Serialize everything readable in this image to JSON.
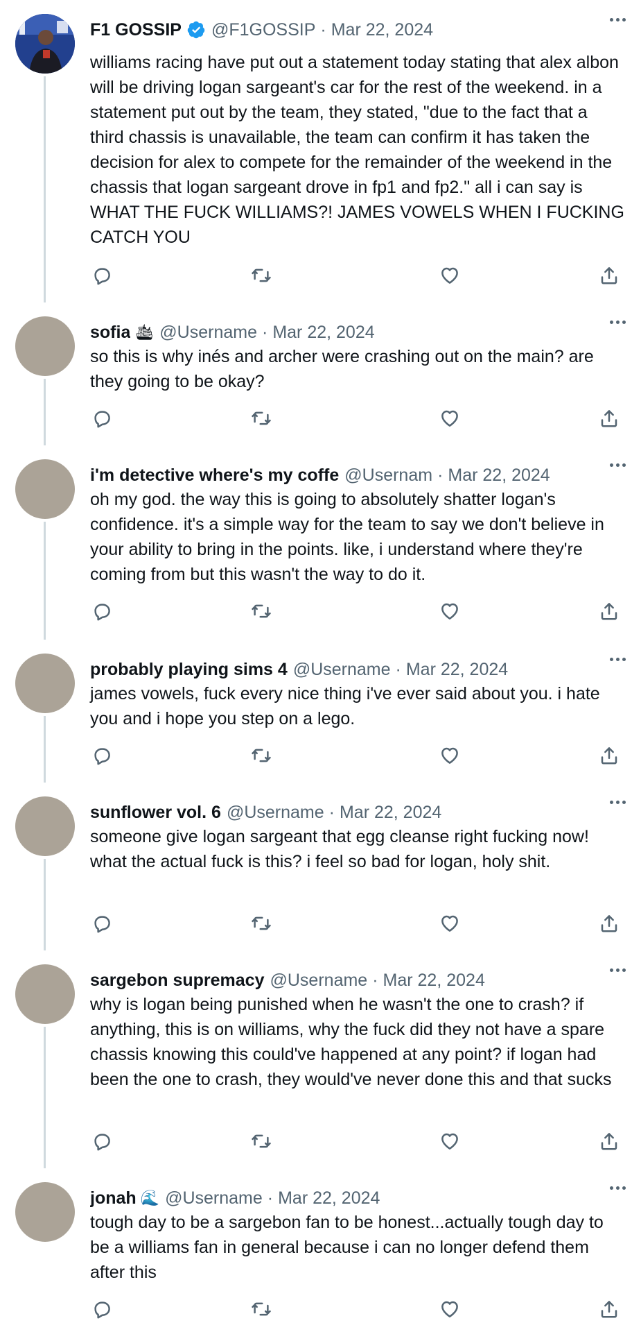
{
  "tweets": [
    {
      "name": "F1 GOSSIP",
      "verified": true,
      "handle": "@F1GOSSIP",
      "sep": "·",
      "date": "Mar 22, 2024",
      "text": "williams racing have put out a statement today stating that alex albon will be driving logan sargeant's car for the rest of the weekend. in a statement put out by the team, they stated, \"due to the fact that a third chassis is unavailable, the team can confirm it has taken the decision for alex to compete for the remainder of the weekend in the chassis that logan sargeant drove in fp1 and fp2.\" all i can say is WHAT THE FUCK WILLIAMS?! JAMES VOWELS WHEN I FUCKING CATCH YOU"
    },
    {
      "name": "sofia",
      "emoji": "🛳",
      "handle": "@Username",
      "sep": "·",
      "date": "Mar 22, 2024",
      "text": "so this is why inés and archer were crashing out on the main? are they going to be okay?"
    },
    {
      "name": "i'm detective where's my coffe",
      "handle": "@Usernam",
      "sep": "·",
      "date": "Mar 22, 2024",
      "text": "oh my god. the way this is going to absolutely shatter logan's confidence. it's a simple way for the team to say we don't believe in your ability to bring in the points. like, i understand where they're coming from but this wasn't the way to do it."
    },
    {
      "name": "probably playing sims 4",
      "handle": "@Username",
      "sep": "·",
      "date": "Mar 22, 2024",
      "text": "james vowels, fuck every nice thing i've ever said about you. i hate you and i hope you step on a lego."
    },
    {
      "name": "sunflower vol. 6",
      "handle": "@Username",
      "sep": "·",
      "date": "Mar 22, 2024",
      "text": "someone give logan sargeant that egg cleanse right fucking now! what the actual fuck is this? i feel so bad for logan, holy shit."
    },
    {
      "name": "sargebon supremacy",
      "handle": "@Username",
      "sep": "·",
      "date": "Mar 22, 2024",
      "text": "why is logan being punished when he wasn't the one to crash? if anything, this is on williams, why the fuck did they not have a spare chassis knowing this could've happened at any point? if logan had been the one to crash, they would've never done this and that sucks"
    },
    {
      "name": "jonah",
      "emoji": "🌊",
      "handle": "@Username",
      "sep": "·",
      "date": "Mar 22, 2024",
      "text": "tough day to be a sargebon fan to be honest...actually tough day to be a williams fan in general because i can no longer defend them after this"
    }
  ],
  "colors": {
    "text": "#0f1419",
    "secondary": "#536471",
    "verified": "#1d9bf0",
    "avatar_placeholder": "#aba397",
    "thread_line": "#cfd9de"
  },
  "icons": [
    "reply-icon",
    "retweet-icon",
    "like-icon",
    "share-icon",
    "more-icon",
    "verified-badge-icon"
  ]
}
